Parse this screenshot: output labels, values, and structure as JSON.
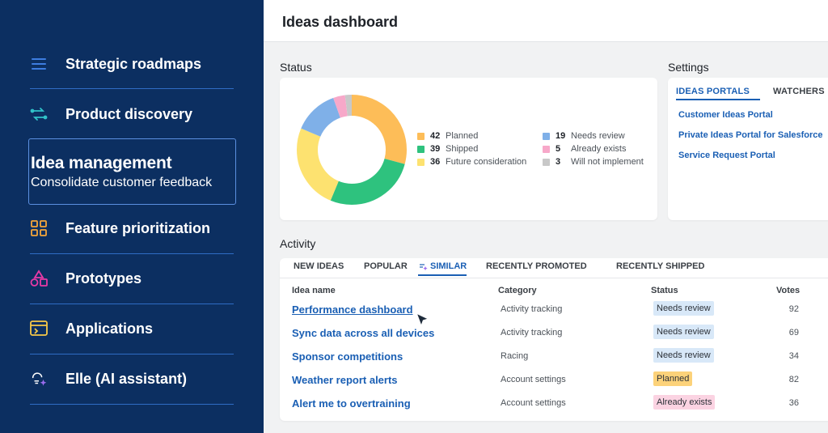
{
  "sidebar": {
    "items": [
      {
        "label": "Strategic roadmaps",
        "icon": "list-icon"
      },
      {
        "label": "Product discovery",
        "icon": "arrows-icon"
      },
      {
        "label": "Feature prioritization",
        "icon": "grid-icon"
      },
      {
        "label": "Prototypes",
        "icon": "shapes-icon"
      },
      {
        "label": "Applications",
        "icon": "window-icon"
      },
      {
        "label": "Elle (AI assistant)",
        "icon": "ai-sparkle-icon"
      }
    ],
    "active": {
      "title": "Idea management",
      "subtitle": "Consolidate customer feedback"
    }
  },
  "header": {
    "title": "Ideas dashboard"
  },
  "status": {
    "title": "Status",
    "legend": [
      {
        "count": "42",
        "label": "Planned",
        "color": "#fdbd58"
      },
      {
        "count": "39",
        "label": "Shipped",
        "color": "#2ec27e"
      },
      {
        "count": "36",
        "label": "Future consideration",
        "color": "#fde270"
      },
      {
        "count": "19",
        "label": "Needs review",
        "color": "#7fb0e8"
      },
      {
        "count": "5",
        "label": "Already exists",
        "color": "#f7a8c9"
      },
      {
        "count": "3",
        "label": "Will not implement",
        "color": "#c8c8c8"
      }
    ]
  },
  "settings": {
    "title": "Settings",
    "tabs": [
      "IDEAS PORTALS",
      "WATCHERS"
    ],
    "links": [
      "Customer Ideas Portal",
      "Private Ideas Portal for Salesforce",
      "Service Request Portal"
    ]
  },
  "activity": {
    "title": "Activity",
    "tabs": [
      "NEW IDEAS",
      "POPULAR",
      "SIMILAR",
      "RECENTLY PROMOTED",
      "RECENTLY SHIPPED"
    ],
    "columns": [
      "Idea name",
      "Category",
      "Status",
      "Votes"
    ],
    "rows": [
      {
        "name": "Performance dashboard",
        "category": "Activity tracking",
        "status": "Needs review",
        "status_color": "#d8e8f8",
        "votes": "92"
      },
      {
        "name": "Sync data across all devices",
        "category": "Activity tracking",
        "status": "Needs review",
        "status_color": "#d8e8f8",
        "votes": "69"
      },
      {
        "name": "Sponsor competitions",
        "category": "Racing",
        "status": "Needs review",
        "status_color": "#d8e8f8",
        "votes": "34"
      },
      {
        "name": "Weather report alerts",
        "category": "Account settings",
        "status": "Planned",
        "status_color": "#fcd27a",
        "votes": "82"
      },
      {
        "name": "Alert me to overtraining",
        "category": "Account settings",
        "status": "Already exists",
        "status_color": "#fbd3e2",
        "votes": "36"
      }
    ]
  }
}
